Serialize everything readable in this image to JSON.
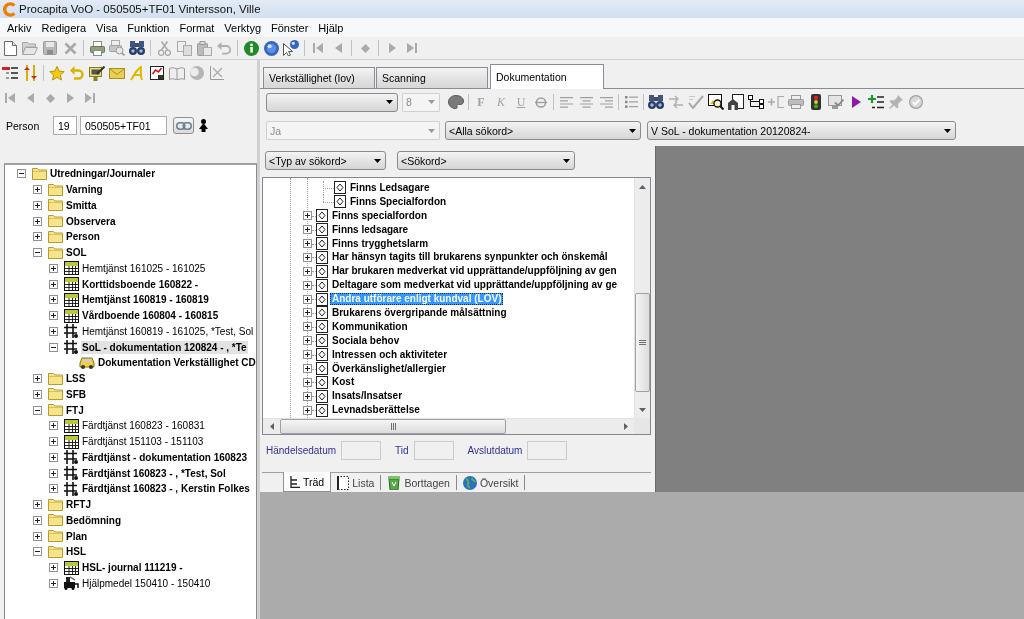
{
  "window": {
    "title": "Procapita VoO - 050505+TF01 Vintersson, Ville"
  },
  "menu": [
    "Arkiv",
    "Redigera",
    "Visa",
    "Funktion",
    "Format",
    "Verktyg",
    "Fönster",
    "Hjälp"
  ],
  "person": {
    "label": "Person",
    "number": "19",
    "id": "050505+TF01"
  },
  "journal_tree": [
    {
      "label": "Utredningar/Journaler",
      "kind": "folder",
      "bold": true,
      "expanded": true,
      "selected": false,
      "children": [
        {
          "label": "Varning",
          "kind": "folder",
          "bold": true,
          "expanded": false,
          "selected": false
        },
        {
          "label": "Smitta",
          "kind": "folder",
          "bold": true,
          "expanded": false,
          "selected": false
        },
        {
          "label": "Observera",
          "kind": "folder",
          "bold": true,
          "expanded": false,
          "selected": false
        },
        {
          "label": "Person",
          "kind": "folder",
          "bold": true,
          "expanded": false,
          "selected": false
        },
        {
          "label": "SOL",
          "kind": "folder",
          "bold": true,
          "expanded": true,
          "selected": false,
          "children": [
            {
              "label": "Hemtjänst 161025 - 161025",
              "kind": "calendar",
              "bold": false,
              "expanded": false,
              "selected": false
            },
            {
              "label": "Korttidsboende 160822 -",
              "kind": "calendar",
              "bold": true,
              "expanded": false,
              "selected": false
            },
            {
              "label": "Hemtjänst 160819 - 160819",
              "kind": "calendar",
              "bold": true,
              "expanded": false,
              "selected": false
            },
            {
              "label": "Vårdboende 160804 - 160815",
              "kind": "calendar",
              "bold": true,
              "expanded": false,
              "selected": false
            },
            {
              "label": "Hemtjänst 160819 - 161025, *Test, Sol",
              "kind": "plan",
              "bold": false,
              "expanded": false,
              "selected": false
            },
            {
              "label": "SoL - dokumentation 120824 - , *Te",
              "kind": "plan",
              "bold": true,
              "expanded": true,
              "selected": true,
              "children": [
                {
                  "label": "Dokumentation Verkställighet CD",
                  "kind": "vehicle",
                  "bold": true,
                  "selected": false
                }
              ]
            }
          ]
        },
        {
          "label": "LSS",
          "kind": "folder",
          "bold": true,
          "expanded": false,
          "selected": false
        },
        {
          "label": "SFB",
          "kind": "folder",
          "bold": true,
          "expanded": false,
          "selected": false
        },
        {
          "label": "FTJ",
          "kind": "folder",
          "bold": true,
          "expanded": true,
          "selected": false,
          "children": [
            {
              "label": "Färdtjänst 160823 - 160831",
              "kind": "calendar",
              "bold": false,
              "expanded": false,
              "selected": false
            },
            {
              "label": "Färdtjänst 151103 - 151103",
              "kind": "calendar",
              "bold": false,
              "expanded": false,
              "selected": false
            },
            {
              "label": "Färdtjänst - dokumentation 160823",
              "kind": "plan",
              "bold": true,
              "expanded": false,
              "selected": false
            },
            {
              "label": "Färdtjänst 160823 - , *Test, Sol",
              "kind": "plan",
              "bold": true,
              "expanded": false,
              "selected": false
            },
            {
              "label": "Färdtjänst 160823 - , Kerstin Folkes",
              "kind": "plan",
              "bold": true,
              "expanded": false,
              "selected": false
            }
          ]
        },
        {
          "label": "RFTJ",
          "kind": "folder",
          "bold": true,
          "expanded": false,
          "selected": false
        },
        {
          "label": "Bedömning",
          "kind": "folder",
          "bold": true,
          "expanded": false,
          "selected": false
        },
        {
          "label": "Plan",
          "kind": "folder",
          "bold": true,
          "expanded": false,
          "selected": false
        },
        {
          "label": "HSL",
          "kind": "folder",
          "bold": true,
          "expanded": true,
          "selected": false,
          "children": [
            {
              "label": "HSL- journal 111219 -",
              "kind": "calendar",
              "bold": true,
              "expanded": false,
              "selected": false
            },
            {
              "label": "Hjälpmedel 150410 - 150410",
              "kind": "aid",
              "bold": false,
              "expanded": false,
              "selected": false
            }
          ]
        }
      ]
    }
  ],
  "document_tabs": [
    {
      "label": "Verkställighet (lov)",
      "selected": false
    },
    {
      "label": "Scanning",
      "selected": false
    },
    {
      "label": "Dokumentation",
      "selected": true
    }
  ],
  "format_toolbar": {
    "font": {
      "disabled": false
    },
    "size": {
      "value": "8",
      "disabled": true
    },
    "style_buttons": [
      {
        "label": "F",
        "kind": "bold",
        "disabled": true
      },
      {
        "label": "K",
        "kind": "italic",
        "disabled": true
      },
      {
        "label": "U",
        "kind": "underline",
        "disabled": true
      }
    ]
  },
  "filters": [
    {
      "value": "Ja",
      "disabled": true
    },
    {
      "value": "<Alla sökord>",
      "disabled": false
    },
    {
      "value": "V SoL - dokumentation 20120824-",
      "disabled": false
    }
  ],
  "keyword_filters": [
    {
      "value": "<Typ av sökord>",
      "disabled": false
    },
    {
      "value": "<Sökord>",
      "disabled": false
    }
  ],
  "term_tree": [
    {
      "children": [
        {
          "label": "Finns Ledsagare",
          "selected": false
        },
        {
          "label": "Finns Specialfordon",
          "selected": false
        }
      ]
    },
    {
      "label": "Finns specialfordon",
      "expanded": false,
      "selected": false
    },
    {
      "label": "Finns ledsagare",
      "expanded": false,
      "selected": false
    },
    {
      "label": "Finns trygghetslarm",
      "expanded": false,
      "selected": false
    },
    {
      "label": "Har hänsyn tagits till brukarens synpunkter och önskemål",
      "expanded": false,
      "selected": false
    },
    {
      "label": "Har brukaren medverkat vid upprättande/uppföljning av gen",
      "expanded": false,
      "selected": false
    },
    {
      "label": "Deltagare som medverkat vid upprättande/uppföljning av ge",
      "expanded": false,
      "selected": false
    },
    {
      "label": "Andra utförare enligt kundval (LOV)",
      "expanded": false,
      "selected": true
    },
    {
      "label": "Brukarens övergripande målsättning",
      "expanded": false,
      "selected": false
    },
    {
      "label": "Kommunikation",
      "expanded": false,
      "selected": false
    },
    {
      "label": "Sociala behov",
      "expanded": false,
      "selected": false
    },
    {
      "label": "Intressen och aktiviteter",
      "expanded": false,
      "selected": false
    },
    {
      "label": "Överkänslighet/allergier",
      "expanded": false,
      "selected": false
    },
    {
      "label": "Kost",
      "expanded": false,
      "selected": false
    },
    {
      "label": "Insats/Insatser",
      "expanded": false,
      "selected": false
    },
    {
      "label": "Levnadsberättelse",
      "expanded": false,
      "selected": false
    }
  ],
  "date_fields": [
    {
      "label": "Händelsedatum",
      "disabled": true
    },
    {
      "label": "Tid",
      "disabled": true
    },
    {
      "label": "Avslutdatum",
      "disabled": true
    }
  ],
  "view_tabs": [
    {
      "label": "Träd",
      "selected": true
    },
    {
      "label": "Lista",
      "selected": false
    },
    {
      "label": "Borttagen",
      "selected": false
    },
    {
      "label": "Översikt",
      "selected": false
    }
  ]
}
